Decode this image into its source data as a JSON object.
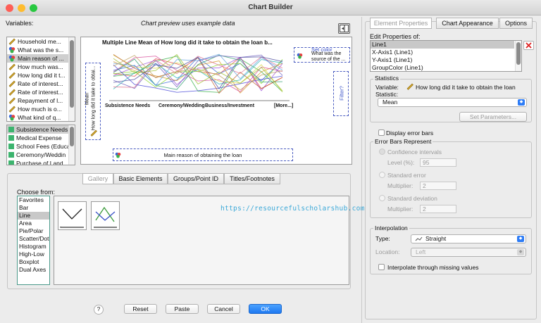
{
  "window": {
    "title": "Chart Builder"
  },
  "preview_note": "Chart preview uses example data",
  "variables": {
    "label": "Variables:",
    "items": [
      {
        "label": "Household me...",
        "icon": "scale-icon"
      },
      {
        "label": "What was the s...",
        "icon": "nominal-icon"
      },
      {
        "label": "Main reason of ...",
        "icon": "nominal-icon",
        "selected": true
      },
      {
        "label": "How much was...",
        "icon": "scale-icon"
      },
      {
        "label": "How long did it t...",
        "icon": "scale-icon"
      },
      {
        "label": "Rate of interest...",
        "icon": "scale-icon"
      },
      {
        "label": "Rate of interest...",
        "icon": "scale-icon"
      },
      {
        "label": "Repayment of l...",
        "icon": "scale-icon"
      },
      {
        "label": "How much  is o...",
        "icon": "scale-icon"
      },
      {
        "label": "What kind of q...",
        "icon": "nominal-icon"
      }
    ],
    "categories": [
      "Subsistence Needs",
      "Medical Expense",
      "School Fees (Educa",
      "Ceremony/Weddin",
      "Purchase of Land"
    ]
  },
  "chart_preview": {
    "title": "Multiple Line Mean of How long did it take to obtain the loan b...",
    "x_ticks": [
      "Subsistence Needs",
      "Ceremony/Wedding",
      "Business/Investment",
      "[More...]"
    ],
    "y_axis_label": "Mean",
    "y_drop_label": "How long did it take to obtai...",
    "x_drop_label": "Main reason of obtaining the loan",
    "set_color_label": "Set color",
    "color_drop_label": "What was the source of the ...",
    "filter_label": "Filter?"
  },
  "gallery_tabs": [
    "Gallery",
    "Basic Elements",
    "Groups/Point ID",
    "Titles/Footnotes"
  ],
  "choose_from": {
    "label": "Choose from:",
    "items": [
      "Favorites",
      "Bar",
      "Line",
      "Area",
      "Pie/Polar",
      "Scatter/Dot",
      "Histogram",
      "High-Low",
      "Boxplot",
      "Dual Axes"
    ],
    "selected_index": 2
  },
  "watermark": "https://resourcefulscholarshub.com",
  "buttons": {
    "help": "?",
    "reset": "Reset",
    "paste": "Paste",
    "cancel": "Cancel",
    "ok": "OK"
  },
  "right_tabs": [
    "Element Properties",
    "Chart Appearance",
    "Options"
  ],
  "edit_properties": {
    "label": "Edit Properties of:",
    "items": [
      "Line1",
      "X-Axis1 (Line1)",
      "Y-Axis1 (Line1)",
      "GroupColor (Line1)"
    ],
    "selected_index": 0
  },
  "statistics": {
    "legend": "Statistics",
    "variable_label": "Variable:",
    "variable_value": "How long did it take to obtain the loan",
    "statistic_label": "Statistic:",
    "statistic_value": "Mean",
    "set_parameters": "Set Parameters..."
  },
  "error_bars": {
    "display_label": "Display error bars",
    "legend": "Error Bars Represent",
    "ci_label": "Confidence intervals",
    "level_label": "Level (%):",
    "level_value": "95",
    "se_label": "Standard error",
    "se_mult_label": "Multiplier:",
    "se_mult_value": "2",
    "sd_label": "Standard deviation",
    "sd_mult_label": "Multiplier:",
    "sd_mult_value": "2"
  },
  "interpolation": {
    "legend": "Interpolation",
    "type_label": "Type:",
    "type_value": "Straight",
    "location_label": "Location:",
    "location_value": "Left",
    "missing_label": "Interpolate through missing values"
  },
  "colors": {
    "accent": "#1e78f0",
    "category_green": "#3cb46e",
    "dashed_zone": "#4a5cc0"
  }
}
